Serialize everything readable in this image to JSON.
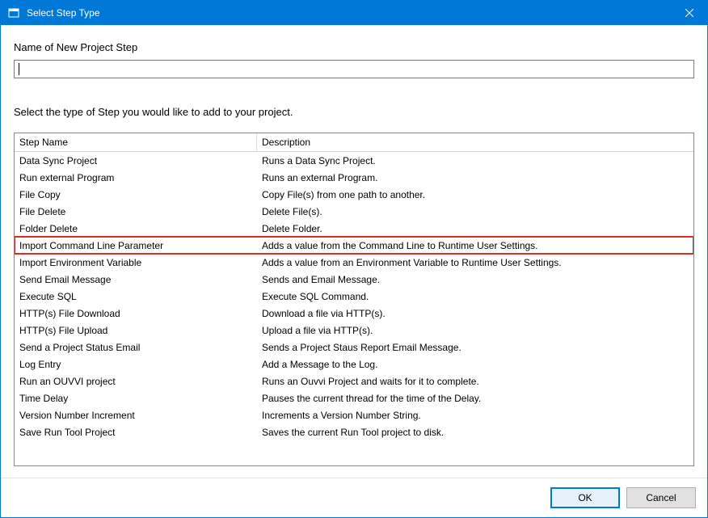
{
  "title": "Select Step Type",
  "labels": {
    "name_field": "Name of New Project Step",
    "instruction": "Select the type of Step you would like to add to your project."
  },
  "input_value": "",
  "columns": {
    "name": "Step Name",
    "description": "Description"
  },
  "highlighted_index": 5,
  "steps": [
    {
      "name": "Data Sync Project",
      "description": "Runs a Data Sync Project."
    },
    {
      "name": "Run external Program",
      "description": "Runs an external Program."
    },
    {
      "name": "File Copy",
      "description": "Copy File(s) from one path to another."
    },
    {
      "name": "File Delete",
      "description": "Delete File(s)."
    },
    {
      "name": "Folder Delete",
      "description": "Delete Folder."
    },
    {
      "name": "Import Command Line Parameter",
      "description": "Adds a value from the Command Line to Runtime User Settings."
    },
    {
      "name": "Import Environment Variable",
      "description": "Adds a value from an Environment Variable to Runtime User Settings."
    },
    {
      "name": "Send Email Message",
      "description": "Sends and Email Message."
    },
    {
      "name": "Execute SQL",
      "description": "Execute SQL Command."
    },
    {
      "name": "HTTP(s) File Download",
      "description": "Download a file via HTTP(s)."
    },
    {
      "name": "HTTP(s) File Upload",
      "description": "Upload a file via HTTP(s)."
    },
    {
      "name": "Send a Project Status Email",
      "description": "Sends a Project Staus Report Email Message."
    },
    {
      "name": "Log Entry",
      "description": "Add a Message to the Log."
    },
    {
      "name": "Run an OUVVI project",
      "description": "Runs an Ouvvi Project and waits for it to complete."
    },
    {
      "name": "Time Delay",
      "description": "Pauses the current thread for the time of the Delay."
    },
    {
      "name": "Version Number Increment",
      "description": "Increments a Version Number String."
    },
    {
      "name": "Save Run Tool Project",
      "description": "Saves the current Run Tool project to disk."
    }
  ],
  "buttons": {
    "ok": "OK",
    "cancel": "Cancel"
  }
}
